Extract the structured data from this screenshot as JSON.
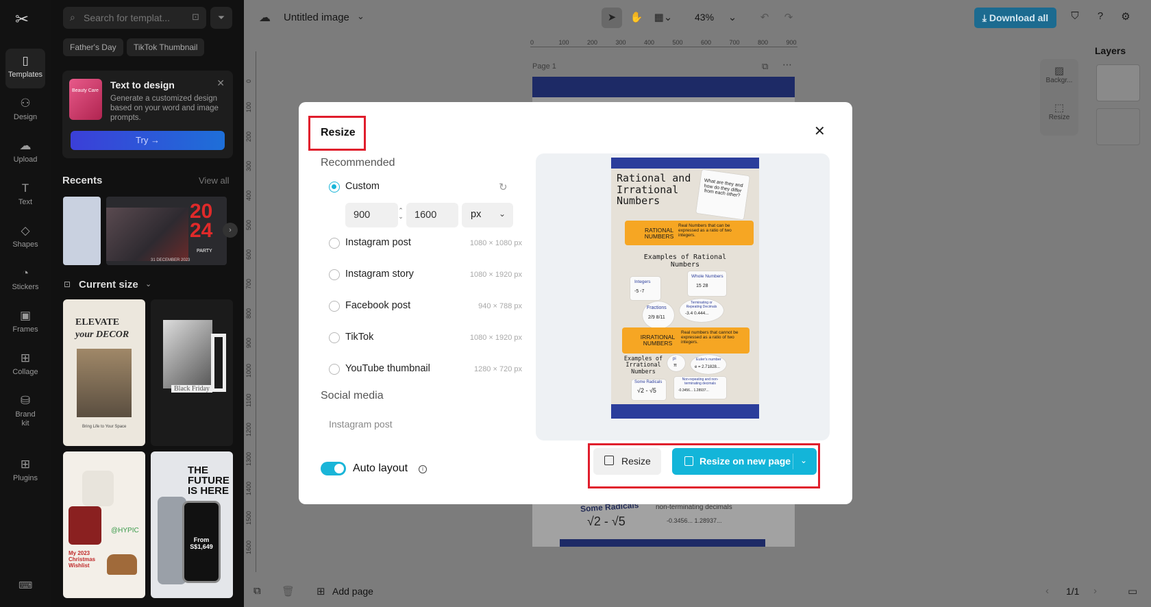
{
  "rail": {
    "logo": "✂",
    "items": [
      {
        "label": "Templates",
        "icon": "template-icon"
      },
      {
        "label": "Design",
        "icon": "design-icon"
      },
      {
        "label": "Upload",
        "icon": "upload-icon"
      },
      {
        "label": "Text",
        "icon": "text-icon"
      },
      {
        "label": "Shapes",
        "icon": "shapes-icon"
      },
      {
        "label": "Stickers",
        "icon": "stickers-icon"
      },
      {
        "label": "Frames",
        "icon": "frames-icon"
      },
      {
        "label": "Collage",
        "icon": "collage-icon"
      },
      {
        "label": "Brand kit",
        "icon": "brand-kit-icon"
      },
      {
        "label": "Plugins",
        "icon": "plugins-icon"
      }
    ]
  },
  "panel": {
    "search_placeholder": "Search for templat...",
    "chips": [
      "Father's Day",
      "TikTok Thumbnail"
    ],
    "text_to_design": {
      "thumb_text": "Beauty Care",
      "title": "Text to design",
      "description": "Generate a customized design based on your word and image prompts.",
      "try_label": "Try →"
    },
    "recents_title": "Recents",
    "view_all": "View all",
    "recent_party_year": "20 24",
    "recent_party_sub": "PARTY",
    "recent_party_date": "31 DECEMBER 2023",
    "current_size": "Current size",
    "templates": {
      "elevate_line1": "ELEVATE",
      "elevate_line2": "your DECOR",
      "elevate_sub": "Bring Life to Your Space",
      "black_friday": "Black Friday",
      "christmas_brand": "@HYPIC",
      "christmas_title": "My 2023 Christmas Wishlist",
      "phone_title": "THE FUTURE IS HERE",
      "phone_price": "From S$1,649"
    }
  },
  "topbar": {
    "doc_title": "Untitled image",
    "zoom": "43%",
    "download_label": "Download all"
  },
  "canvas": {
    "ruler_top": [
      "0",
      "100",
      "200",
      "300",
      "400",
      "500",
      "600",
      "700",
      "800",
      "900"
    ],
    "ruler_left": [
      "0",
      "100",
      "200",
      "300",
      "400",
      "500",
      "600",
      "700",
      "800",
      "900",
      "1000",
      "1100",
      "1200",
      "1300",
      "1400",
      "1500",
      "1600"
    ],
    "page_label": "Page 1",
    "bottom_text_1": "Some Radicals",
    "bottom_text_2": "non-terminating decimals",
    "bottom_text_3": "√2  -  √5",
    "bottom_text_4": "-0.3456...  1.28937..."
  },
  "layers": {
    "title": "Layers",
    "side_tools": [
      "Backgr...",
      "Resize"
    ]
  },
  "bottombar": {
    "add_page": "Add page",
    "page_count": "1/1"
  },
  "modal": {
    "title": "Resize",
    "recommended": "Recommended",
    "custom_label": "Custom",
    "width": "900",
    "height": "1600",
    "unit": "px",
    "options": [
      {
        "label": "Instagram post",
        "size": "1080 × 1080 px"
      },
      {
        "label": "Instagram story",
        "size": "1080 × 1920 px"
      },
      {
        "label": "Facebook post",
        "size": "940 × 788 px"
      },
      {
        "label": "TikTok",
        "size": "1080 × 1920 px"
      },
      {
        "label": "YouTube thumbnail",
        "size": "1280 × 720 px"
      }
    ],
    "social_media": "Social media",
    "social_first": "Instagram post",
    "auto_layout": "Auto layout",
    "resize_btn": "Resize",
    "resize_new_btn": "Resize on new page",
    "preview": {
      "title": "Rational and Irrational Numbers",
      "question": "What are they and how do they differ from each other?",
      "rational": "RATIONAL NUMBERS",
      "rational_def": "Real Numbers that can be expressed as a ratio of two integers.",
      "examples_rational": "Examples of Rational Numbers",
      "integers": "Integers",
      "integers_vals": "-5   -7",
      "whole": "Whole Numbers",
      "whole_vals": "15   28",
      "fractions": "Fractions",
      "fractions_vals": "2/9  8/11",
      "terminating": "Terminating or Repeating Decimals",
      "terminating_vals": "-3.4   0.444...",
      "irrational": "IRRATIONAL NUMBERS",
      "irrational_def": "Real numbers that cannot be expressed as a ratio of two integers.",
      "examples_irrational": "Examples of Irrational Numbers",
      "pi": "pi",
      "pi_sym": "π",
      "euler": "Euler's number",
      "euler_val": "e = 2.71828...",
      "radicals": "Some Radicals",
      "radicals_vals": "√2  -  √5",
      "nonterm": "Non-repeating and non-terminating decimals",
      "nonterm_vals": "-0.3456...  1.28937..."
    }
  },
  "colors": {
    "accent": "#13b5d9",
    "highlight": "#e01d2c",
    "download": "#1c6b90"
  }
}
